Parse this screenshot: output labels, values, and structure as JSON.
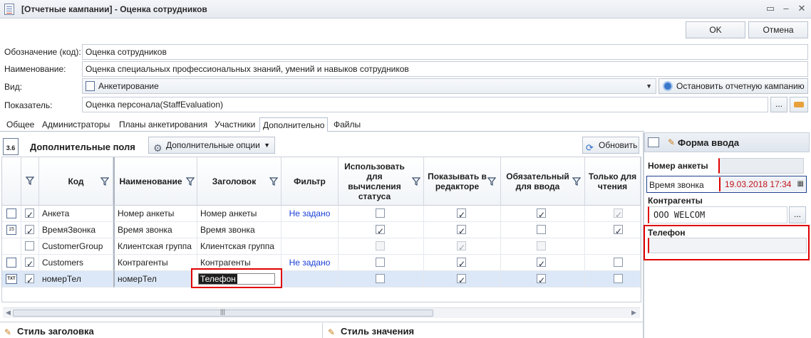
{
  "window": {
    "title": "[Отчетные кампании] - Оценка сотрудников"
  },
  "actions": {
    "ok": "OK",
    "cancel": "Отмена"
  },
  "form": {
    "code_label": "Обозначение (код):",
    "code_value": "Оценка сотрудников",
    "name_label": "Наименование:",
    "name_value": "Оценка специальных профессиональных знаний, умений и навыков сотрудников",
    "kind_label": "Вид:",
    "kind_value": "Анкетирование",
    "stop_label": "Остановить отчетную кампанию",
    "indicator_label": "Показатель:",
    "indicator_value": "Оценка персонала(StaffEvaluation)",
    "ellipsis": "..."
  },
  "tabs": [
    "Общее",
    "Администраторы",
    "Планы анкетирования",
    "Участники",
    "Дополнительно",
    "Файлы"
  ],
  "fields_panel": {
    "title": "Дополнительные поля",
    "options": "Дополнительные опции",
    "refresh": "Обновить",
    "icon_text": "3.6"
  },
  "grid": {
    "headers": {
      "code": "Код",
      "name": "Наименование",
      "caption": "Заголовок",
      "filter": "Фильтр",
      "status": "Использовать для вычисления статуса",
      "show": "Показывать в редакторе",
      "required": "Обязательный для ввода",
      "readonly": "Только для чтения"
    },
    "rows": [
      {
        "code": "Анкета",
        "name": "Номер анкеты",
        "caption": "Номер анкеты",
        "filter": "Не задано"
      },
      {
        "code": "ВремяЗвонка",
        "name": "Время звонка",
        "caption": "Время звонка",
        "filter": ""
      },
      {
        "code": "CustomerGroup",
        "name": "Клиентская группа",
        "caption": "Клиентская группа",
        "filter": ""
      },
      {
        "code": "Customers",
        "name": "Контрагенты",
        "caption": "Контрагенты",
        "filter": "Не задано"
      },
      {
        "code": "номерТел",
        "name": "номерТел",
        "caption": "Телефон",
        "filter": ""
      }
    ],
    "row_icon_text": "TXT"
  },
  "bottom": {
    "caption_style": "Стиль заголовка",
    "value_style": "Стиль значения"
  },
  "preview": {
    "title": "Форма ввода",
    "number_label": "Номер анкеты",
    "call_label": "Время звонка",
    "call_value": "19.03.2018 17:34",
    "customers_label": "Контрагенты",
    "customers_value": "ООО WELCOM",
    "phone_label": "Телефон",
    "ellipsis": "..."
  }
}
